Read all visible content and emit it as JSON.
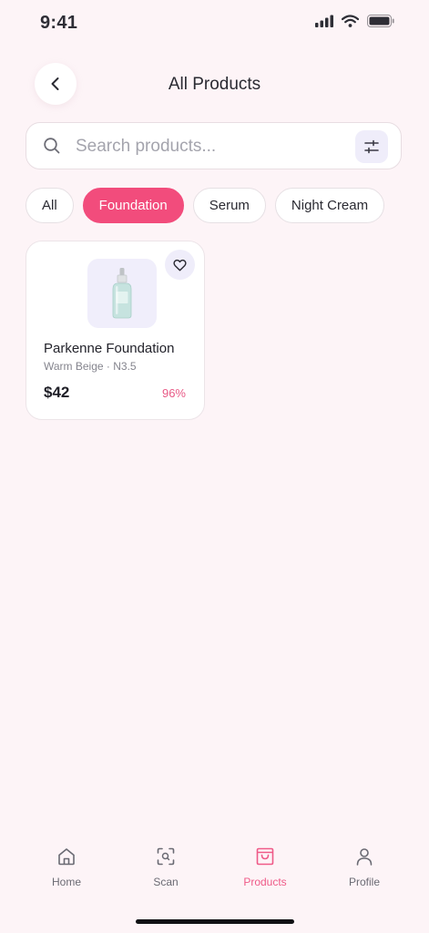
{
  "status_bar": {
    "time": "9:41",
    "icons": [
      "signal-icon",
      "wifi-icon",
      "battery-icon"
    ]
  },
  "header": {
    "back_icon": "chevron-left-icon",
    "title": "All Products"
  },
  "search": {
    "placeholder": "Search products...",
    "value": "",
    "icon": "search-icon",
    "filter_icon": "sliders-icon"
  },
  "filters": {
    "chips": [
      {
        "label": "All",
        "active": false
      },
      {
        "label": "Foundation",
        "active": true
      },
      {
        "label": "Serum",
        "active": false
      },
      {
        "label": "Night Cream",
        "active": false
      }
    ]
  },
  "products": [
    {
      "name": "Parkenne Foundation",
      "variant": "Warm Beige · N3.5",
      "price": "$42",
      "match": "96%",
      "image_icon": "serum-bottle-icon",
      "favorite_icon": "heart-icon"
    }
  ],
  "bottom_nav": {
    "items": [
      {
        "label": "Home",
        "icon": "home-icon",
        "active": false
      },
      {
        "label": "Scan",
        "icon": "scan-icon",
        "active": false
      },
      {
        "label": "Products",
        "icon": "shopping-bag-icon",
        "active": true
      },
      {
        "label": "Profile",
        "icon": "user-icon",
        "active": false
      }
    ]
  },
  "colors": {
    "accent": "#f24c7c",
    "background": "#fdf4f7",
    "chip_active_text": "#ffffff",
    "nav_active": "#ef5a88",
    "icon_tint": "#efedfa"
  }
}
